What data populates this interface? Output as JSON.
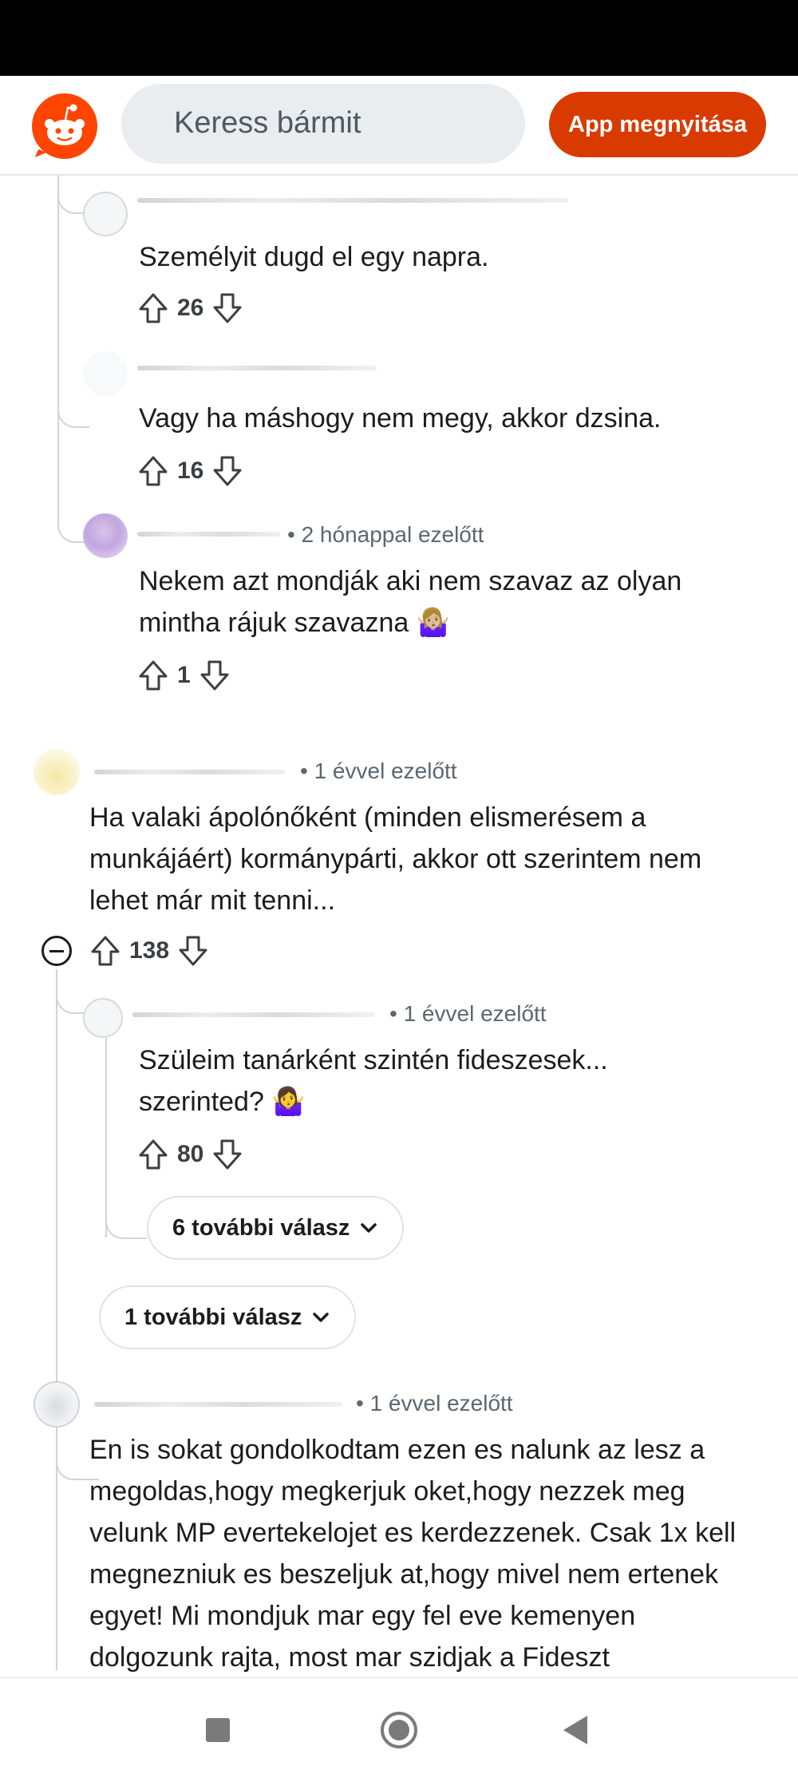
{
  "header": {
    "search_placeholder": "Keress bármit",
    "app_button": "App megnyitása",
    "accent": "#d93a00"
  },
  "comments": [
    {
      "time": "",
      "text": "Személyit dugd el egy napra.",
      "votes": "26"
    },
    {
      "time": "",
      "text": "Vagy ha máshogy nem megy, akkor dzsina.",
      "votes": "16"
    },
    {
      "time": "• 2 hónappal ezelőtt",
      "text_lines": [
        "Nekem azt mondják aki nem szavaz az olyan",
        "mintha rájuk szavazna 🤷🏼‍♀️"
      ],
      "votes": "1"
    },
    {
      "time": "• 1 évvel ezelőtt",
      "text_lines": [
        "Ha valaki ápolónőként (minden elismerésem a",
        "munkájáért) kormánypárti, akkor ott szerintem nem",
        "lehet már mit tenni..."
      ],
      "votes": "138"
    },
    {
      "time": "• 1 évvel ezelőtt",
      "text_lines": [
        "Szüleim tanárként szintén fideszesek...",
        "szerinted? 🤷‍♀️"
      ],
      "votes": "80"
    },
    {
      "time": "• 1 évvel ezelőtt",
      "text_lines": [
        "En is sokat gondolkodtam ezen es nalunk az lesz a",
        "megoldas,hogy megkerjuk oket,hogy nezzek meg",
        "velunk MP evertekelojet es kerdezzenek. Csak 1x kell",
        "megnezniuk es beszeljuk at,hogy mivel nem ertenek",
        "egyet! Mi mondjuk mar egy fel eve kemenyen",
        "dolgozunk rajta, most mar szidjak a Fideszt"
      ]
    }
  ],
  "more_replies": {
    "six": "6 további válasz",
    "one": "1 további válasz"
  },
  "icons": {
    "upvote": "upvote-arrow-icon",
    "downvote": "downvote-arrow-icon",
    "collapse": "collapse-minus-icon",
    "chevron": "chevron-down-icon"
  }
}
